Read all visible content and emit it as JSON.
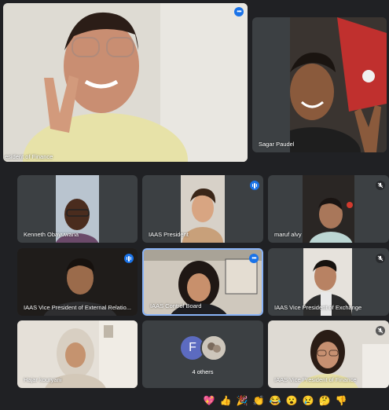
{
  "participants": {
    "main_speaker": {
      "name": "President of Finance",
      "name_display": "esident of Finance"
    },
    "sagar": {
      "name": "Sagar Paudel"
    },
    "kenneth": {
      "name": "Kenneth Obayuwana"
    },
    "iaas_president": {
      "name": "IAAS President"
    },
    "maruf": {
      "name": "maruf alvy"
    },
    "external": {
      "name": "IAAS Vice President of External Relatio..."
    },
    "control_board": {
      "name": "IAAS Control Board"
    },
    "exchange": {
      "name": "IAAS Vice President of Exchange"
    },
    "hajar": {
      "name": "Hajar kouryani"
    },
    "others": {
      "label": "4 others",
      "avatar_letter": "F"
    },
    "finance": {
      "name": "IAAS Vice President of Finance"
    }
  },
  "reactions": [
    "💖",
    "👍",
    "🎉",
    "👏",
    "😂",
    "😮",
    "😢",
    "🤔",
    "👎"
  ],
  "colors": {
    "background": "#202124",
    "tile": "#3c4043",
    "accent_blue": "#1a73e8",
    "active_border": "#8ab4f8",
    "avatar_f": "#5c6bc0"
  },
  "icons": {
    "speaking": "audio-bars-icon",
    "muted": "mic-off-icon",
    "more": "more-options-icon"
  }
}
